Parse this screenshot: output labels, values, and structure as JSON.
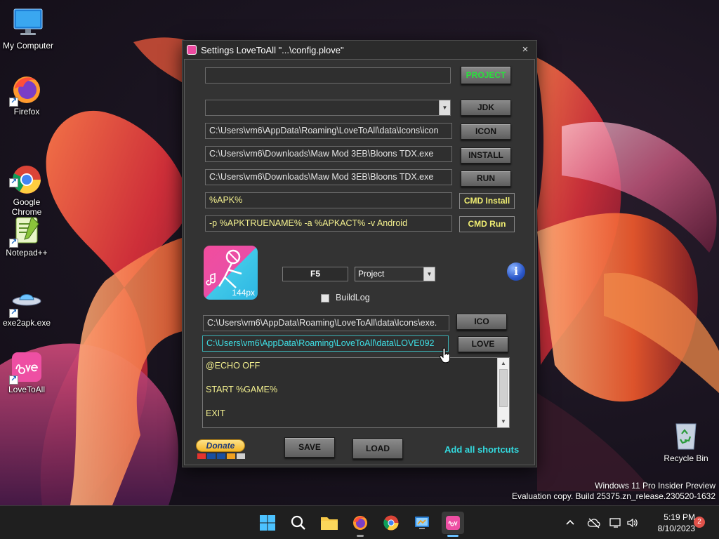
{
  "desktop": {
    "icons": [
      {
        "label": "My Computer"
      },
      {
        "label": "Firefox"
      },
      {
        "label": "Google\nChrome"
      },
      {
        "label": "Notepad++"
      },
      {
        "label": "exe2apk.exe"
      },
      {
        "label": "LoveToAll"
      }
    ],
    "recycle_bin": "Recycle Bin",
    "watermark": {
      "line1": "Windows 11 Pro Insider Preview",
      "line2": "Evaluation copy. Build 25375.zn_release.230520-1632"
    }
  },
  "window": {
    "title": "Settings LoveToAll \"...\\config.plove\"",
    "close_glyph": "×",
    "project": {
      "value": "",
      "button": "PROJECT"
    },
    "jdk": {
      "value": "",
      "button": "JDK"
    },
    "icon": {
      "value": "C:\\Users\\vm6\\AppData\\Roaming\\LoveToAll\\data\\Icons\\icon",
      "button": "ICON"
    },
    "install": {
      "value": "C:\\Users\\vm6\\Downloads\\Maw Mod 3EB\\Bloons TDX.exe",
      "button": "INSTALL"
    },
    "run": {
      "value": "C:\\Users\\vm6\\Downloads\\Maw Mod 3EB\\Bloons TDX.exe",
      "button": "RUN"
    },
    "cmd_install": {
      "value": "%APK%",
      "button": "CMD Install"
    },
    "cmd_run": {
      "value": "-p %APKTRUENAME% -a %APKACT% -v Android",
      "button": "CMD Run"
    },
    "logo_text": "144px",
    "hotkey": "F5",
    "mode_select": "Project",
    "info_glyph": "i",
    "buildlog_label": "BuildLog",
    "ico": {
      "value": "C:\\Users\\vm6\\AppData\\Roaming\\LoveToAll\\data\\Icons\\exe.",
      "button": "ICO"
    },
    "love": {
      "value": "C:\\Users\\vm6\\AppData\\Roaming\\LoveToAll\\data\\LOVE092",
      "button": "LOVE"
    },
    "script_lines": [
      "@ECHO OFF",
      "START %GAME%",
      "EXIT"
    ],
    "donate_label": "Donate",
    "save_button": "SAVE",
    "load_button": "LOAD",
    "add_shortcuts": "Add all shortcuts"
  },
  "taskbar": {
    "time": "5:19 PM",
    "date": "8/10/2023",
    "notification_count": "2",
    "tray_chevron": "^"
  }
}
